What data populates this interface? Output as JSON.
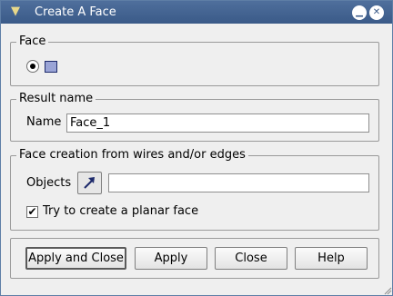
{
  "window": {
    "title": "Create A Face"
  },
  "face_group": {
    "legend": "Face"
  },
  "result_group": {
    "legend": "Result name",
    "name_label": "Name",
    "name_value": "Face_1"
  },
  "wires_group": {
    "legend": "Face creation from wires and/or edges",
    "objects_label": "Objects",
    "objects_value": "",
    "planar_label": "Try to create a planar face",
    "planar_checked": "✔"
  },
  "buttons": {
    "apply_close": "Apply and Close",
    "apply": "Apply",
    "close": "Close",
    "help": "Help"
  }
}
